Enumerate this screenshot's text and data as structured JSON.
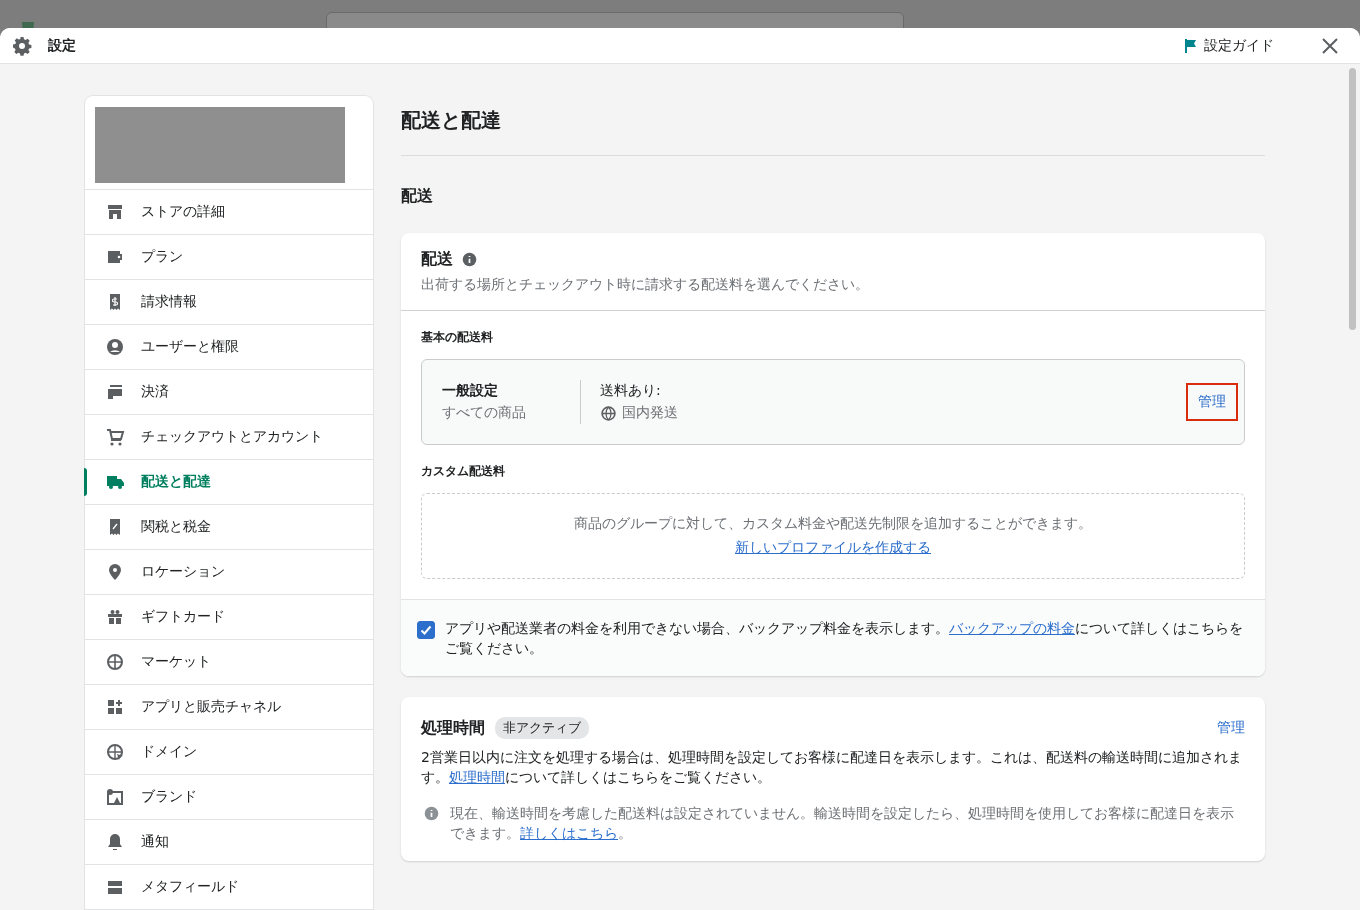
{
  "window": {
    "title": "設定",
    "guide": "設定ガイド"
  },
  "sidebar": {
    "items": [
      {
        "label": "ストアの詳細",
        "selected": false
      },
      {
        "label": "プラン",
        "selected": false
      },
      {
        "label": "請求情報",
        "selected": false
      },
      {
        "label": "ユーザーと権限",
        "selected": false
      },
      {
        "label": "決済",
        "selected": false
      },
      {
        "label": "チェックアウトとアカウント",
        "selected": false
      },
      {
        "label": "配送と配達",
        "selected": true
      },
      {
        "label": "関税と税金",
        "selected": false
      },
      {
        "label": "ロケーション",
        "selected": false
      },
      {
        "label": "ギフトカード",
        "selected": false
      },
      {
        "label": "マーケット",
        "selected": false
      },
      {
        "label": "アプリと販売チャネル",
        "selected": false
      },
      {
        "label": "ドメイン",
        "selected": false
      },
      {
        "label": "ブランド",
        "selected": false
      },
      {
        "label": "通知",
        "selected": false
      },
      {
        "label": "メタフィールド",
        "selected": false
      }
    ]
  },
  "page_title": "配送と配達",
  "section_title": "配送",
  "shipping_card": {
    "title": "配送",
    "description": "出荷する場所とチェックアウト時に請求する配送料を選んでください。",
    "general_heading": "基本の配送料",
    "profile": {
      "name": "一般設定",
      "scope": "すべての商品",
      "rates_label": "送料あり:",
      "zone": "国内発送",
      "action": "管理",
      "highlighted": true
    },
    "custom_heading": "カスタム配送料",
    "custom_text": "商品のグループに対して、カスタム料金や配送先制限を追加することができます。",
    "custom_link": "新しいプロファイルを作成する",
    "backup": {
      "checked": true,
      "before": "アプリや配送業者の料金を利用できない場合、バックアップ料金を表示します。",
      "link": "バックアップの料金",
      "after": "について詳しくはこちらをご覧ください。"
    }
  },
  "processing_card": {
    "title": "処理時間",
    "status": "非アクティブ",
    "action": "管理",
    "before": "2営業日以内に注文を処理する場合は、処理時間を設定してお客様に配達日を表示します。これは、配送料の輸送時間に追加されます。",
    "link": "処理時間",
    "after": "について詳しくはこちらをご覧ください。",
    "note_before": "現在、輸送時間を考慮した配送料は設定されていません。輸送時間を設定したら、処理時間を使用してお客様に配達日を表示できます。",
    "note_link": "詳しくはこちら",
    "note_after": "。"
  }
}
